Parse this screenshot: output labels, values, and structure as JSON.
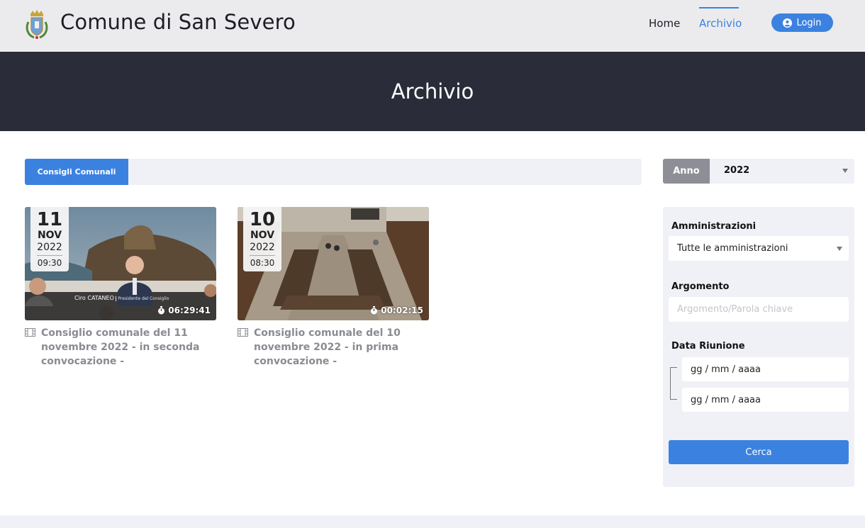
{
  "header": {
    "site_title": "Comune di San Severo",
    "nav": {
      "home": "Home",
      "archivio": "Archivio"
    },
    "login_label": "Login",
    "accent_color": "#3b82e0"
  },
  "hero": {
    "title": "Archivio"
  },
  "tabs": {
    "active_label": "Consigli Comunali"
  },
  "year_filter": {
    "label": "Anno",
    "value": "2022"
  },
  "videos": [
    {
      "day": "11",
      "month": "NOV",
      "year": "2022",
      "time": "09:30",
      "duration": "06:29:41",
      "title": "Consiglio comunale del 11 novembre 2022 - in seconda convocazione -",
      "caption": "Ciro CATANEO",
      "caption_sub": "Presidente del Consiglio"
    },
    {
      "day": "10",
      "month": "NOV",
      "year": "2022",
      "time": "08:30",
      "duration": "00:02:15",
      "title": "Consiglio comunale del 10 novembre 2022 - in prima convocazione -"
    }
  ],
  "filters": {
    "amministrazioni_label": "Amministrazioni",
    "amministrazioni_value": "Tutte le amministrazioni",
    "argomento_label": "Argomento",
    "argomento_placeholder": "Argomento/Parola chiave",
    "data_label": "Data Riunione",
    "date_from": "gg / mm / aaaa",
    "date_to": "gg / mm / aaaa",
    "search_label": "Cerca"
  }
}
